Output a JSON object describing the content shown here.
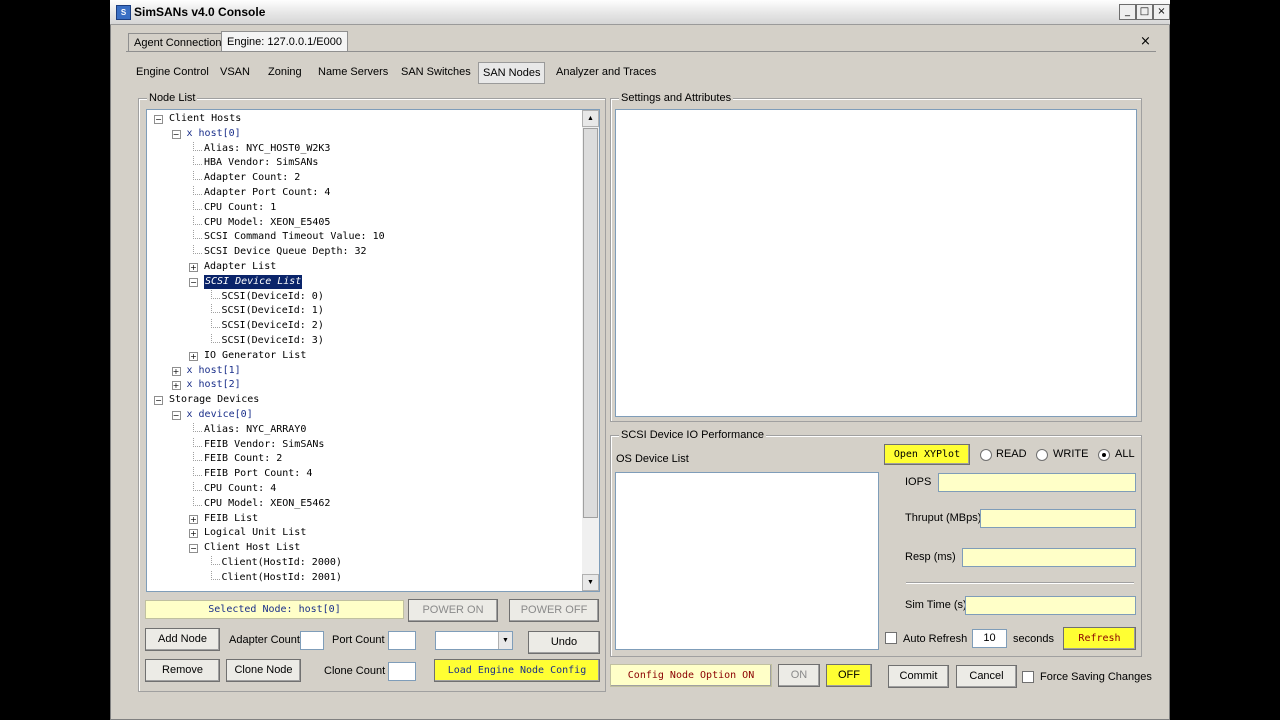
{
  "window": {
    "title": "SimSANs v4.0 Console",
    "controls": [
      "_",
      "□",
      "×"
    ]
  },
  "doc_tabs": [
    {
      "label": "Agent Connections",
      "active": false
    },
    {
      "label": "Engine: 127.0.0.1/E000",
      "active": true
    }
  ],
  "doc_close": "×",
  "page_tabs": [
    "Engine Control",
    "VSAN",
    "Zoning",
    "Name Servers",
    "SAN Switches",
    "SAN Nodes",
    "Analyzer and Traces"
  ],
  "active_page_tab": "SAN Nodes",
  "node_list": {
    "title": "Node List",
    "tree": [
      {
        "text": "Client Hosts",
        "expander": "minus"
      },
      {
        "text": "x host[0]",
        "expander": "minus",
        "accent": true
      },
      {
        "text": "Alias: NYC_HOST0_W2K3"
      },
      {
        "text": "HBA Vendor: SimSANs"
      },
      {
        "text": "Adapter Count: 2"
      },
      {
        "text": "Adapter Port Count: 4"
      },
      {
        "text": "CPU Count: 1"
      },
      {
        "text": "CPU Model: XEON_E5405"
      },
      {
        "text": "SCSI Command Timeout Value: 10"
      },
      {
        "text": "SCSI Device Queue Depth: 32"
      },
      {
        "text": "Adapter List",
        "expander": "plus"
      },
      {
        "text": "SCSI Device List",
        "expander": "minus",
        "selected": true
      },
      {
        "text": "SCSI(DeviceId: 0)"
      },
      {
        "text": "SCSI(DeviceId: 1)"
      },
      {
        "text": "SCSI(DeviceId: 2)"
      },
      {
        "text": "SCSI(DeviceId: 3)"
      },
      {
        "text": "IO Generator List",
        "expander": "plus"
      },
      {
        "text": "x host[1]",
        "expander": "plus",
        "accent": true
      },
      {
        "text": "x host[2]",
        "expander": "plus",
        "accent": true
      },
      {
        "text": "Storage Devices",
        "expander": "minus"
      },
      {
        "text": "x device[0]",
        "expander": "minus",
        "accent": true
      },
      {
        "text": "Alias: NYC_ARRAY0"
      },
      {
        "text": "FEIB Vendor: SimSANs"
      },
      {
        "text": "FEIB Count: 2"
      },
      {
        "text": "FEIB Port Count: 4"
      },
      {
        "text": "CPU Count: 4"
      },
      {
        "text": "CPU Model: XEON_E5462"
      },
      {
        "text": "FEIB List",
        "expander": "plus"
      },
      {
        "text": "Logical Unit List",
        "expander": "plus"
      },
      {
        "text": "Client Host List",
        "expander": "minus"
      },
      {
        "text": "Client(HostId: 2000)"
      },
      {
        "text": "Client(HostId: 2001)"
      }
    ],
    "selected_node": "Selected Node: host[0]",
    "power_on": "POWER ON",
    "power_off": "POWER OFF",
    "add_node": "Add Node",
    "adapter_count_label": "Adapter Count",
    "port_count_label": "Port Count",
    "undo": "Undo",
    "remove": "Remove",
    "clone_node": "Clone Node",
    "clone_count_label": "Clone Count",
    "load_config": "Load Engine Node Config"
  },
  "settings": {
    "title": "Settings and Attributes"
  },
  "perf": {
    "title": "SCSI Device IO Performance",
    "os_device_list": "OS Device List",
    "open_xyplot": "Open XYPlot",
    "read": "READ",
    "write": "WRITE",
    "all": "ALL",
    "iops": "IOPS",
    "thruput": "Thruput (MBps)",
    "resp": "Resp (ms)",
    "simtime": "Sim Time (s)",
    "auto_refresh": "Auto Refresh",
    "refresh_value": "10",
    "seconds": "seconds",
    "refresh": "Refresh"
  },
  "bottom": {
    "config_option": "Config Node Option ON",
    "on": "ON",
    "off": "OFF",
    "commit": "Commit",
    "cancel": "Cancel",
    "force_saving": "Force Saving Changes"
  }
}
